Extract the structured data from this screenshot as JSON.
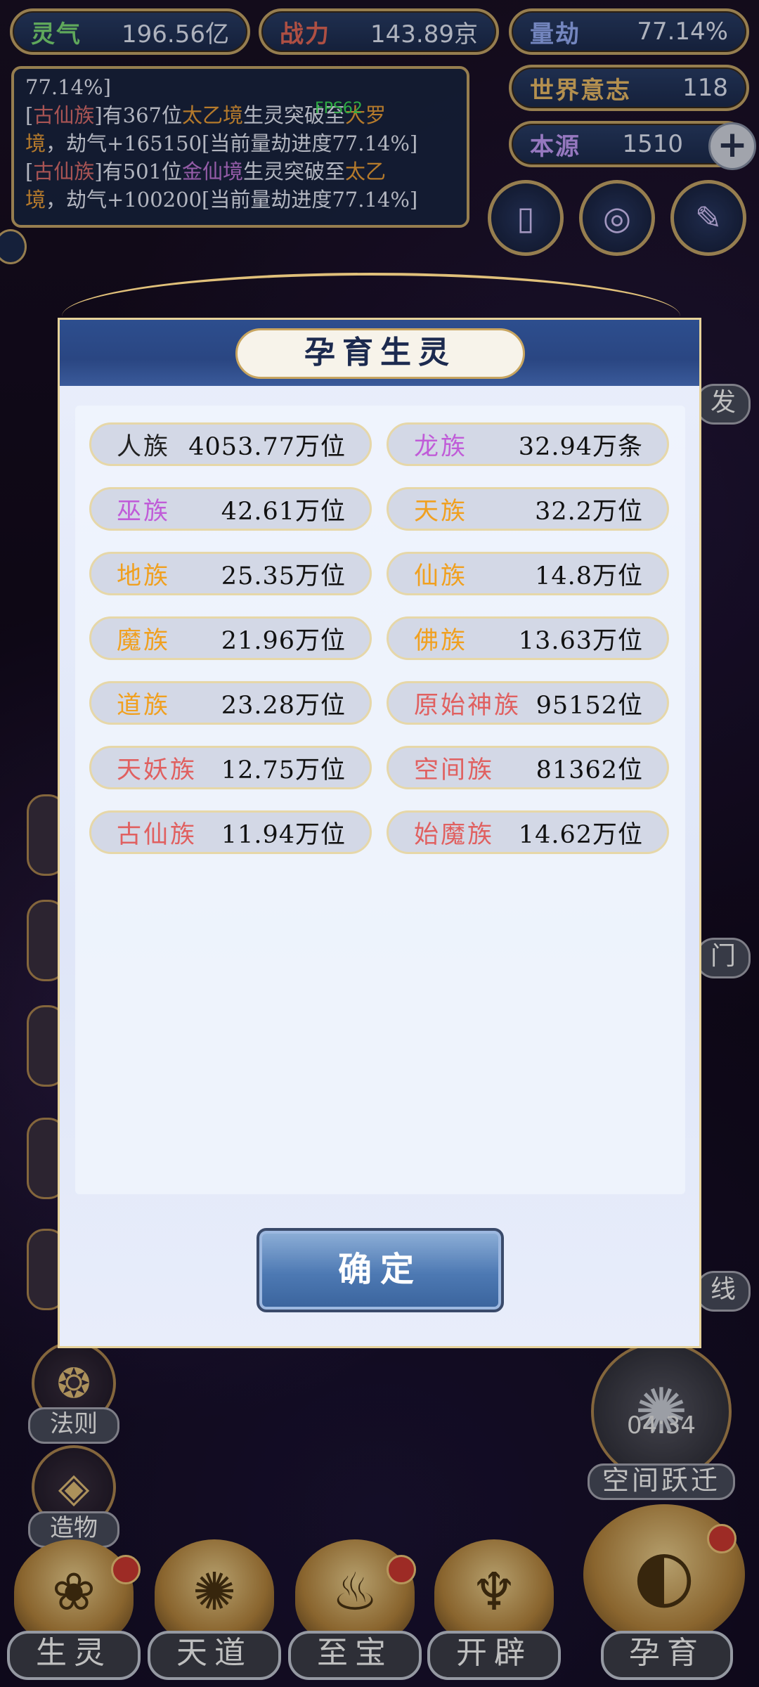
{
  "stats": {
    "lingqi": {
      "label": "灵气",
      "value": "196.56亿",
      "color": "#7fe07a"
    },
    "zhanli": {
      "label": "战力",
      "value": "143.89京",
      "color": "#e86a5a"
    },
    "liangjie": {
      "label": "量劫",
      "value": "77.14%",
      "color": "#9bb3ff"
    },
    "shijie": {
      "label": "世界意志",
      "value": "118",
      "color": "#f0c06a"
    },
    "benyuan": {
      "label": "本源",
      "value": "1510",
      "color": "#c8a0ff"
    }
  },
  "plus_icon": "+",
  "fps": "FPS62",
  "log": {
    "line0": "77.14%]",
    "l1_a": "[",
    "l1_race": "古仙族",
    "l1_b": "]有367位",
    "l1_realm": "太乙境",
    "l1_c": "生灵突破至",
    "l1_target": "大罗",
    "l1_target2": "境",
    "l1_d": "，劫气+165150[当前量劫进度77.14%]",
    "l2_a": "[",
    "l2_race": "古仙族",
    "l2_b": "]有501位",
    "l2_realm": "金仙境",
    "l2_c": "生灵突破至",
    "l2_target": "太乙",
    "l2_target2": "境",
    "l2_d": "，劫气+100200[当前量劫进度77.14%]"
  },
  "left_buttons": [
    "法则",
    "造物"
  ],
  "right_button": {
    "label": "空间跃迁",
    "timer": "04:34"
  },
  "right_partial": [
    "发",
    "门",
    "线"
  ],
  "bottom_nav": [
    "生灵",
    "天道",
    "至宝",
    "开辟",
    "孕育"
  ],
  "modal": {
    "title": "孕育生灵",
    "confirm": "确定",
    "races": [
      {
        "name": "人族",
        "count": "4053.77万位",
        "color": "#222222"
      },
      {
        "name": "龙族",
        "count": "32.94万条",
        "color": "#c05cd8"
      },
      {
        "name": "巫族",
        "count": "42.61万位",
        "color": "#c05cd8"
      },
      {
        "name": "天族",
        "count": "32.2万位",
        "color": "#f0a020"
      },
      {
        "name": "地族",
        "count": "25.35万位",
        "color": "#f0a020"
      },
      {
        "name": "仙族",
        "count": "14.8万位",
        "color": "#f0a020"
      },
      {
        "name": "魔族",
        "count": "21.96万位",
        "color": "#f0a020"
      },
      {
        "name": "佛族",
        "count": "13.63万位",
        "color": "#f0a020"
      },
      {
        "name": "道族",
        "count": "23.28万位",
        "color": "#f0a020"
      },
      {
        "name": "原始神族",
        "count": "95152位",
        "color": "#e06060"
      },
      {
        "name": "天妖族",
        "count": "12.75万位",
        "color": "#e06060"
      },
      {
        "name": "空间族",
        "count": "81362位",
        "color": "#e06060"
      },
      {
        "name": "古仙族",
        "count": "11.94万位",
        "color": "#e06060"
      },
      {
        "name": "始魔族",
        "count": "14.62万位",
        "color": "#e06060"
      }
    ]
  }
}
